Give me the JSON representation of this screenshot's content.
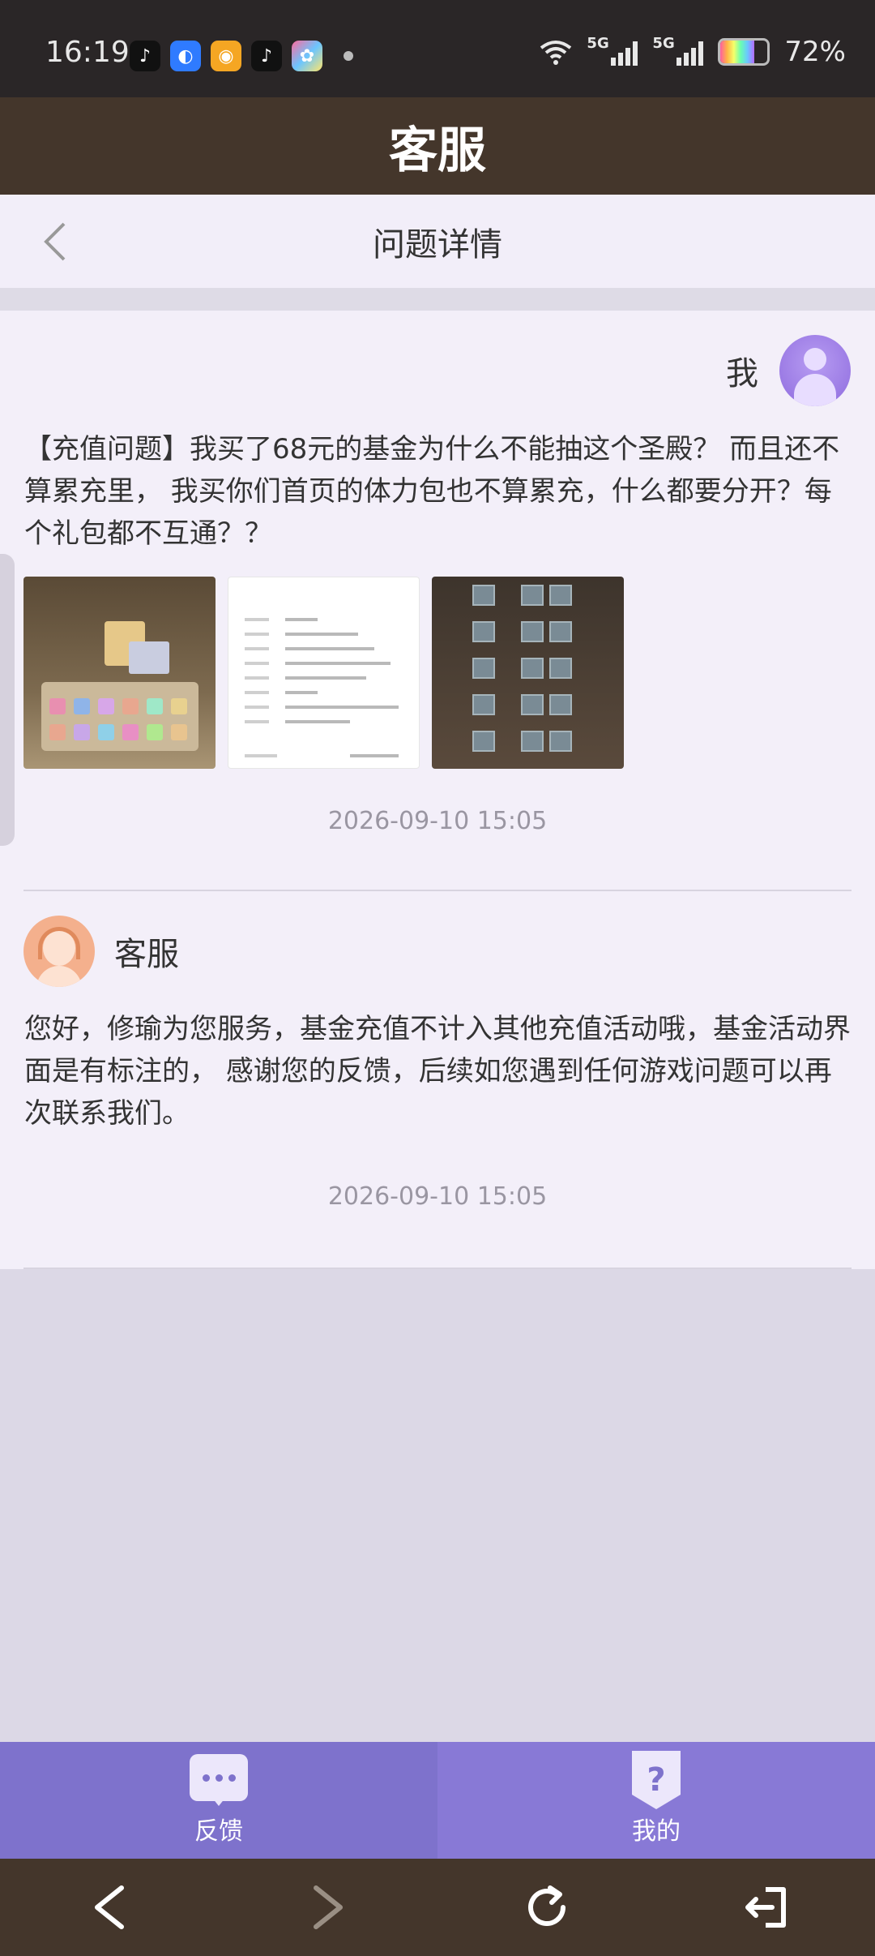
{
  "status_bar": {
    "time": "16:19",
    "network_label_1": "5G",
    "network_label_2": "5G",
    "battery_text": "72%",
    "battery_level": 0.72
  },
  "header": {
    "title": "客服"
  },
  "subheader": {
    "title": "问题详情",
    "back_icon": "chevron-left-icon"
  },
  "user_message": {
    "sender": "我",
    "text": "【充值问题】我买了68元的基金为什么不能抽这个圣殿？ 而且还不算累充里， 我买你们首页的体力包也不算累充，什么都要分开？每个礼包都不互通？？",
    "timestamp": "2026-09-10  15:05"
  },
  "cs_message": {
    "sender": "客服",
    "text": "您好，修瑜为您服务，基金充值不计入其他充值活动哦，基金活动界面是有标注的， 感谢您的反馈，后续如您遇到任何游戏问题可以再次联系我们。",
    "timestamp": "2026-09-10  15:05"
  },
  "bottom_nav": {
    "items": [
      {
        "label": "反馈",
        "icon": "chat-bubble-icon"
      },
      {
        "label": "我的",
        "icon": "question-shield-icon"
      }
    ]
  },
  "system_nav": {
    "icons": [
      "back-arrow-icon",
      "forward-arrow-icon",
      "refresh-icon",
      "exit-icon"
    ]
  },
  "colors": {
    "header_bg": "#44362b",
    "content_bg": "#f3eff9",
    "nav_accent": "#7e72cc"
  }
}
